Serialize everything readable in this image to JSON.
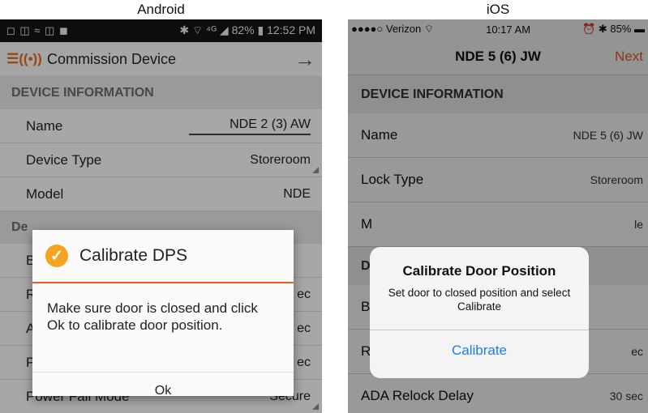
{
  "captions": {
    "android": "Android",
    "ios": "iOS"
  },
  "android": {
    "status": {
      "icons": "◻ ◫ ≈ ◫ ◼",
      "right": "✱ ⌔ ⁴ᴳ ◢ 82% ▮ 12:52 PM"
    },
    "toolbar": {
      "logo": "☰((•))",
      "title": "Commission Device",
      "next": "→"
    },
    "section": "DEVICE INFORMATION",
    "rows": [
      {
        "label": "Name",
        "value": "NDE 2 (3) AW"
      },
      {
        "label": "Device Type",
        "value": "Storeroom"
      },
      {
        "label": "Model",
        "value": "NDE"
      }
    ],
    "section2": "De",
    "bg_rows": [
      {
        "label": "B",
        "value": ""
      },
      {
        "label": "R",
        "value": "ec"
      },
      {
        "label": "A",
        "value": "ec"
      },
      {
        "label": "P",
        "value": "ec"
      },
      {
        "label": "Power Fail Mode",
        "value": "Secure"
      }
    ],
    "dialog": {
      "icon": "check-circle",
      "title": "Calibrate DPS",
      "message": "Make sure door is closed and click Ok to calibrate door position.",
      "button": "Ok"
    },
    "accent": "#e0621b"
  },
  "ios": {
    "status": {
      "carrier": "●●●●○ Verizon ⌔",
      "time": "10:17 AM",
      "right": "⏰ ✱ 85% ▬"
    },
    "nav": {
      "title": "NDE 5 (6) JW",
      "next": "Next"
    },
    "section": "DEVICE INFORMATION",
    "rows": [
      {
        "label": "Name",
        "value": "NDE 5 (6) JW"
      },
      {
        "label": "Lock Type",
        "value": "Storeroom"
      },
      {
        "label": "M",
        "value": "le"
      }
    ],
    "section2": "D",
    "bg_rows": [
      {
        "label": "B",
        "value": ""
      },
      {
        "label": "R",
        "value": "ec"
      },
      {
        "label": "ADA Relock Delay",
        "value": "30 sec"
      }
    ],
    "alert": {
      "title": "Calibrate Door Position",
      "message": "Set door to closed position and select Calibrate",
      "button": "Calibrate"
    },
    "accent": "#e0621b",
    "link_color": "#1a7ff0"
  }
}
